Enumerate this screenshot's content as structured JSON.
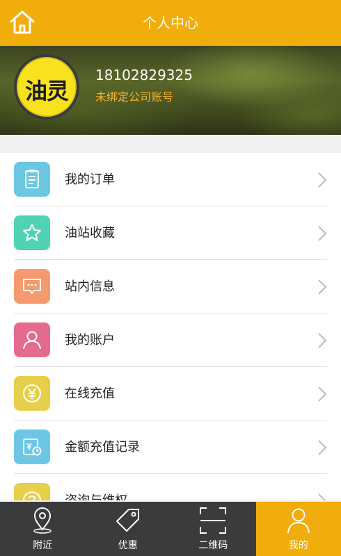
{
  "header": {
    "title": "个人中心"
  },
  "profile": {
    "avatar_text": "油灵",
    "phone": "18102829325",
    "company_status": "未绑定公司账号"
  },
  "menu": {
    "items": [
      {
        "label": "我的订单",
        "icon": "document-icon",
        "color": "#6ac8e2"
      },
      {
        "label": "油站收藏",
        "icon": "star-icon",
        "color": "#4fd3b4"
      },
      {
        "label": "站内信息",
        "icon": "message-icon",
        "color": "#f59a6f"
      },
      {
        "label": "我的账户",
        "icon": "user-icon",
        "color": "#e56b8e"
      },
      {
        "label": "在线充值",
        "icon": "yuan-icon",
        "color": "#e6cf4a"
      },
      {
        "label": "金额充值记录",
        "icon": "record-icon",
        "color": "#6cc6e4"
      },
      {
        "label": "咨询与维权",
        "icon": "help-icon",
        "color": "#e6cf4a"
      }
    ]
  },
  "nav": {
    "tabs": [
      {
        "label": "附近",
        "icon": "location-pin-icon"
      },
      {
        "label": "优惠",
        "icon": "tag-icon"
      },
      {
        "label": "二维码",
        "icon": "scan-icon"
      },
      {
        "label": "我的",
        "icon": "user-icon",
        "active": true
      }
    ]
  },
  "colors": {
    "accent": "#f1ad0b",
    "nav_bg": "#3b3b3b",
    "company_text": "#f3b32e"
  }
}
